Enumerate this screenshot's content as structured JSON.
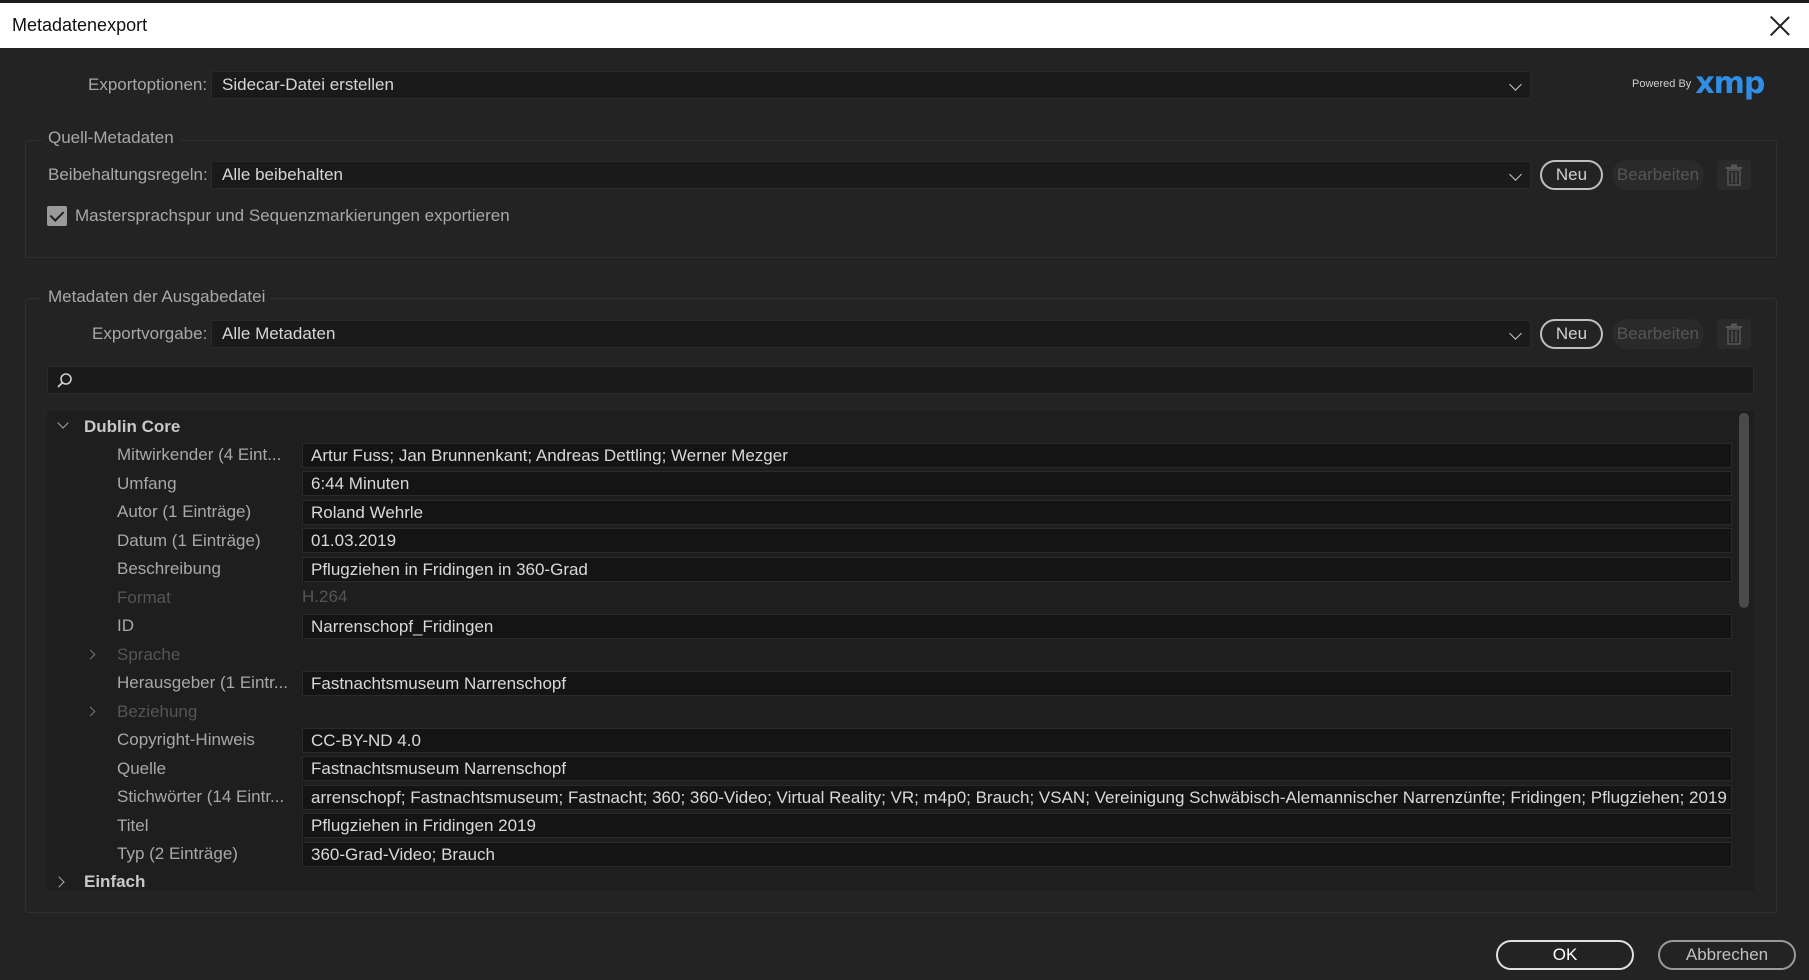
{
  "window": {
    "title": "Metadatenexport"
  },
  "export": {
    "label": "Exportoptionen:",
    "value": "Sidecar-Datei erstellen",
    "powered_by": "Powered By",
    "logo_text": "xmp"
  },
  "source": {
    "panel_title": "Quell-Metadaten",
    "rules_label": "Beibehaltungsregeln:",
    "rules_value": "Alle beibehalten",
    "new_label": "Neu",
    "edit_label": "Bearbeiten",
    "checkbox_label": "Mastersprachspur und Sequenzmarkierungen exportieren"
  },
  "output": {
    "panel_title": "Metadaten der Ausgabedatei",
    "preset_label": "Exportvorgabe:",
    "preset_value": "Alle Metadaten",
    "new_label": "Neu",
    "edit_label": "Bearbeiten",
    "search_placeholder": ""
  },
  "tree": {
    "group1": "Dublin Core",
    "rows": [
      {
        "label": "Mitwirkender (4 Eint...",
        "value": "Artur Fuss; Jan Brunnenkant; Andreas Dettling; Werner Mezger"
      },
      {
        "label": "Umfang",
        "value": "6:44 Minuten"
      },
      {
        "label": "Autor (1 Einträge)",
        "value": "Roland Wehrle"
      },
      {
        "label": "Datum (1 Einträge)",
        "value": "01.03.2019"
      },
      {
        "label": "Beschreibung",
        "value": "Pflugziehen in Fridingen in 360-Grad"
      },
      {
        "label": "Format",
        "value": "H.264"
      },
      {
        "label": "ID",
        "value": "Narrenschopf_Fridingen"
      },
      {
        "label": "Sprache",
        "value": ""
      },
      {
        "label": "Herausgeber (1 Eintr...",
        "value": "Fastnachtsmuseum Narrenschopf"
      },
      {
        "label": "Beziehung",
        "value": ""
      },
      {
        "label": "Copyright-Hinweis",
        "value": "CC-BY-ND 4.0"
      },
      {
        "label": "Quelle",
        "value": "Fastnachtsmuseum Narrenschopf"
      },
      {
        "label": "Stichwörter (14 Eintr...",
        "value": "arrenschopf; Fastnachtsmuseum; Fastnacht; 360; 360-Video; Virtual Reality; VR; m4p0; Brauch; VSAN; Vereinigung Schwäbisch-Alemannischer Narrenzünfte; Fridingen; Pflugziehen; 2019"
      },
      {
        "label": "Titel",
        "value": "Pflugziehen in Fridingen 2019"
      },
      {
        "label": "Typ (2 Einträge)",
        "value": "360-Grad-Video; Brauch"
      }
    ],
    "group2": "Einfach"
  },
  "footer": {
    "ok_label": "OK",
    "cancel_label": "Abbrechen"
  }
}
